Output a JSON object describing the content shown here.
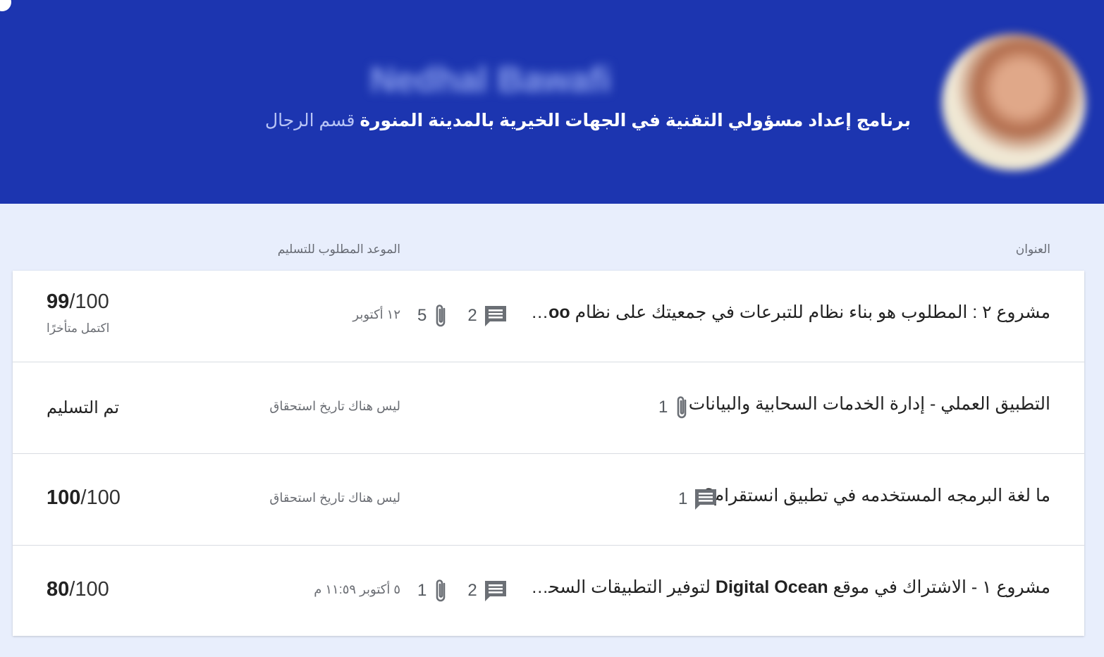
{
  "header": {
    "student_name": "Nedhal Bawafi",
    "course_title": "برنامج إعداد مسؤولي التقنية في الجهات الخيرية بالمدينة المنورة",
    "course_section": "قسم الرجال"
  },
  "columns": {
    "title": "العنوان",
    "due": "الموعد المطلوب للتسليم"
  },
  "assignments": [
    {
      "title_prefix": "مشروع ٢ : المطلوب هو بناء نظام للتبرعات في جمعيتك على نظام ",
      "title_bold": "Odoo",
      "title_suffix": " ...",
      "comments": "2",
      "attachments": "5",
      "due": "١٢ أكتوبر",
      "score": "99",
      "total": "/100",
      "note": "اكتمل متأخرًا"
    },
    {
      "title_prefix": "التطبيق العملي - إدارة الخدمات السحابية والبيانات",
      "title_bold": "",
      "title_suffix": "",
      "attachments": "1",
      "due": "ليس هناك تاريخ استحقاق",
      "status": "تم التسليم"
    },
    {
      "title_prefix": "ما لغة البرمجه المستخدمه في تطبيق انستقرام؟",
      "title_bold": "",
      "title_suffix": "",
      "comments": "1",
      "due": "ليس هناك تاريخ استحقاق",
      "score": "100",
      "total": "/100"
    },
    {
      "title_prefix": "مشروع ١ - الاشتراك في موقع ",
      "title_bold": "Digital Ocean",
      "title_suffix": " لتوفير التطبيقات السحابية...",
      "comments": "2",
      "attachments": "1",
      "due": "٥ أكتوبر ١١:٥٩ م",
      "score": "80",
      "total": "/100"
    }
  ],
  "icons": {
    "comment": "comment-icon",
    "attachment": "paperclip-icon"
  },
  "colors": {
    "header_bg": "#1c35b0",
    "page_bg": "#e8eefc",
    "card_bg": "#ffffff",
    "icon": "#6b6f75"
  }
}
